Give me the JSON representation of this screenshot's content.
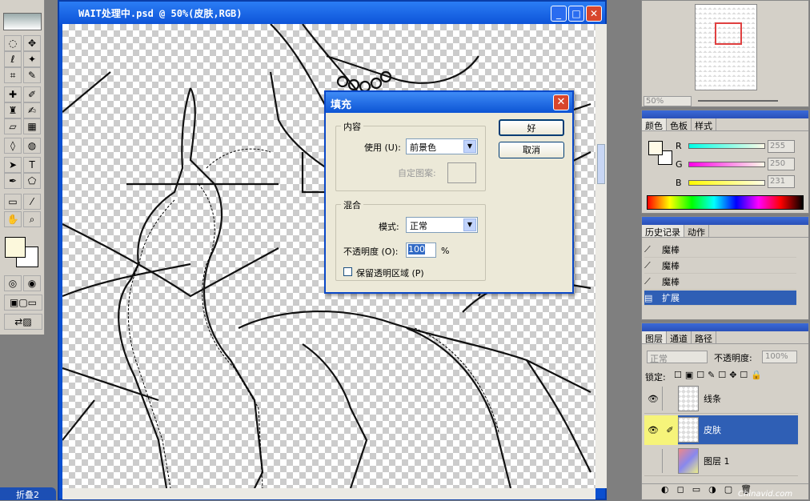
{
  "document": {
    "title": "WAIT处理中.psd @ 50%(皮肤,RGB)",
    "minimize": "_",
    "maximize": "□",
    "close": "✕"
  },
  "dialog": {
    "title": "填充",
    "close": "✕",
    "contents_group": "内容",
    "use_label": "使用 (U):",
    "use_value": "前景色",
    "custom_pattern_label": "自定图案:",
    "blending_group": "混合",
    "mode_label": "模式:",
    "mode_value": "正常",
    "opacity_label": "不透明度 (O):",
    "opacity_value": "100",
    "opacity_unit": "%",
    "preserve_label": "保留透明区域 (P)",
    "preserve_checked": false,
    "ok_label": "好",
    "cancel_label": "取消"
  },
  "navigator": {
    "zoom": "50%"
  },
  "color_panel": {
    "tabs": [
      "颜色",
      "色板",
      "样式"
    ],
    "channels": [
      {
        "label": "R",
        "value": "255"
      },
      {
        "label": "G",
        "value": "250"
      },
      {
        "label": "B",
        "value": "231"
      }
    ],
    "foreground_hex": "#fffae7"
  },
  "history_panel": {
    "tabs": [
      "历史记录",
      "动作"
    ],
    "items": [
      "魔棒",
      "魔棒",
      "魔棒",
      "扩展"
    ],
    "selected_index": 3
  },
  "layers_panel": {
    "tabs": [
      "图层",
      "通道",
      "路径"
    ],
    "blend_mode": "正常",
    "opacity_label": "不透明度:",
    "opacity_value": "100%",
    "lock_label": "锁定:",
    "layers": [
      {
        "name": "线条",
        "visible": true,
        "selected": false
      },
      {
        "name": "皮肤",
        "visible": true,
        "selected": true
      },
      {
        "name": "图层 1",
        "visible": false,
        "selected": false
      }
    ]
  },
  "taskbar": {
    "label": "折叠2"
  },
  "watermark": "Chinavid.com",
  "colors": {
    "title_blue": "#0b51d6",
    "selection_blue": "#2f5fb5",
    "highlight_yellow": "#f6f47a"
  }
}
